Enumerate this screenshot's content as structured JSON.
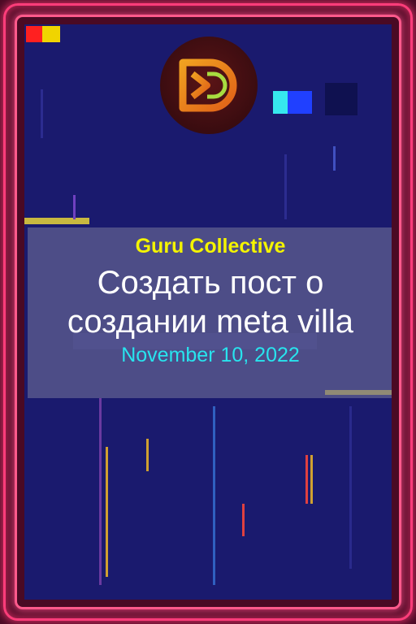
{
  "card": {
    "brand": "Guru Collective",
    "title": "Создать пост о создании meta villa",
    "date": "November 10, 2022"
  },
  "logo": {
    "icon": "guru-collective-logo-icon"
  },
  "colors": {
    "frame": "#ff3d7a",
    "background": "#1a1a6e",
    "brand_text": "#f4f400",
    "title_text": "#ffffff",
    "date_text": "#28e4ee"
  }
}
